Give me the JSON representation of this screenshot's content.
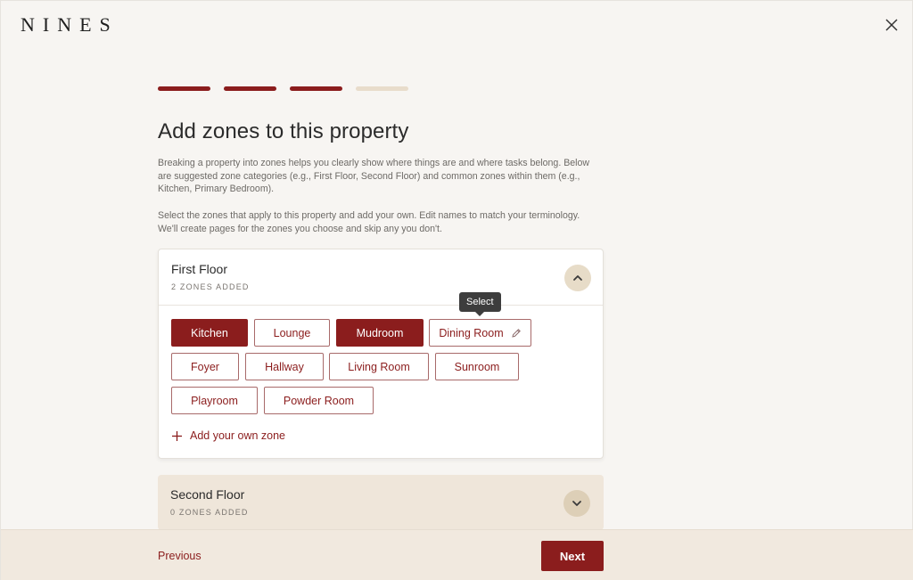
{
  "brand": {
    "logo_text": "NINES"
  },
  "progress": {
    "completed_steps": 3,
    "total_steps": 4
  },
  "page": {
    "title": "Add zones to this property",
    "description_1": "Breaking a property into zones helps you clearly show where things are and where tasks belong. Below are suggested zone categories (e.g., First Floor, Second Floor) and common zones within them (e.g., Kitchen, Primary Bedroom).",
    "description_2": "Select the zones that apply to this property and add your own. Edit names to match your terminology. We'll create pages for the zones you choose and skip any you don't."
  },
  "floors": [
    {
      "name": "First Floor",
      "count_label": "2 ZONES ADDED",
      "expanded": true,
      "zones": [
        {
          "label": "Kitchen",
          "selected": true
        },
        {
          "label": "Lounge",
          "selected": false
        },
        {
          "label": "Mudroom",
          "selected": true
        },
        {
          "label": "Dining Room",
          "selected": false,
          "editable": true
        },
        {
          "label": "Foyer",
          "selected": false
        },
        {
          "label": "Hallway",
          "selected": false
        },
        {
          "label": "Living Room",
          "selected": false
        },
        {
          "label": "Sunroom",
          "selected": false
        },
        {
          "label": "Playroom",
          "selected": false
        },
        {
          "label": "Powder Room",
          "selected": false
        }
      ],
      "add_zone_label": "Add your own zone"
    },
    {
      "name": "Second Floor",
      "count_label": "0 ZONES ADDED",
      "expanded": false
    }
  ],
  "tooltip": {
    "text": "Select"
  },
  "footer": {
    "previous_label": "Previous",
    "next_label": "Next"
  },
  "colors": {
    "accent": "#8b1d1d",
    "progress_todo": "#e8dccb",
    "chevron_bg": "#e7dcc8",
    "footer_bg": "#f1e9df"
  }
}
